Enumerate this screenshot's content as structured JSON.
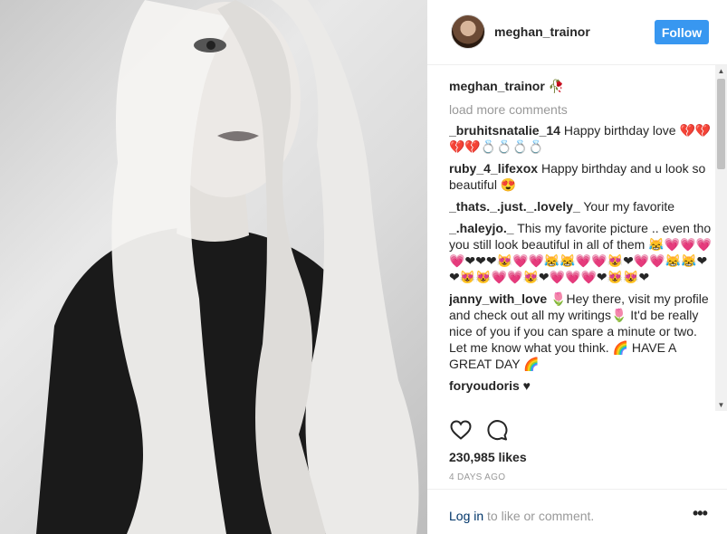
{
  "post": {
    "username": "meghan_trainor",
    "follow_label": "Follow",
    "caption_username": "meghan_trainor",
    "caption_text": "🥀"
  },
  "comments_section": {
    "load_more": "load more comments",
    "comments": [
      {
        "username": "_bruhitsnatalie_14",
        "text": " Happy birthday love 💔💔💔💔💍💍💍💍"
      },
      {
        "username": "ruby_4_lifexox",
        "text": " Happy birthday and u look so beautiful 😍"
      },
      {
        "username": "_thats._.just._.lovely_",
        "text": "  Your my favorite"
      },
      {
        "username": "_.haleyjo._",
        "text": "  This my favorite picture .. even tho you still look beautiful in all of them 😹💗💗💗💗❤❤❤😻💗💗😹😹💗💗😻❤💗💗😹😹❤❤😻😻💗💗😻❤💗💗💗❤😻😻❤"
      },
      {
        "username": "janny_with_love",
        "text": " 🌷Hey there, visit my profile and check out all my writings🌷 It'd be really nice of you if you can spare a minute or two. Let me know what you think. 🌈  HAVE A GREAT DAY 🌈"
      },
      {
        "username": "foryoudoris",
        "text": " ♥"
      }
    ]
  },
  "stats": {
    "likes": "230,985 likes",
    "time_ago": "4 DAYS AGO"
  },
  "footer": {
    "login_link": "Log in",
    "login_rest": " to like or comment.",
    "more_label": "•••"
  },
  "icons": {
    "like": "heart-icon",
    "comment": "comment-bubble-icon",
    "more": "more-options-icon"
  },
  "colors": {
    "accent": "#3897f0",
    "link": "#003569",
    "muted": "#999999"
  }
}
